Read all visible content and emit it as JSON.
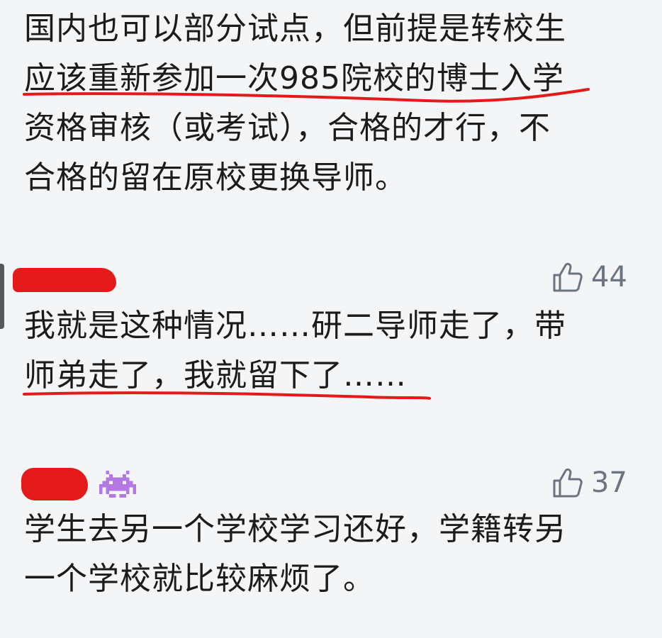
{
  "top_comment": {
    "text": "国内也可以部分试点，但前提是转校生\n应该重新参加一次985院校的博士入学\n资格审核（或考试），合格的才行，不\n合格的留在原校更换导师。"
  },
  "comments": [
    {
      "like_count": "44",
      "text": "我就是这种情况……研二导师走了，带\n师弟走了，我就留下了……"
    },
    {
      "like_count": "37",
      "text": "学生去另一个学校学习还好，学籍转另\n一个学校就比较麻烦了。"
    }
  ],
  "colors": {
    "background": "#f4f5f7",
    "text": "#1b1b1b",
    "like": "#6b7480",
    "annotation_red": "#e41919",
    "badge_purple": "#b478e6"
  },
  "icons": {
    "like": "thumbs-up-icon",
    "badge": "space-invader-icon"
  }
}
